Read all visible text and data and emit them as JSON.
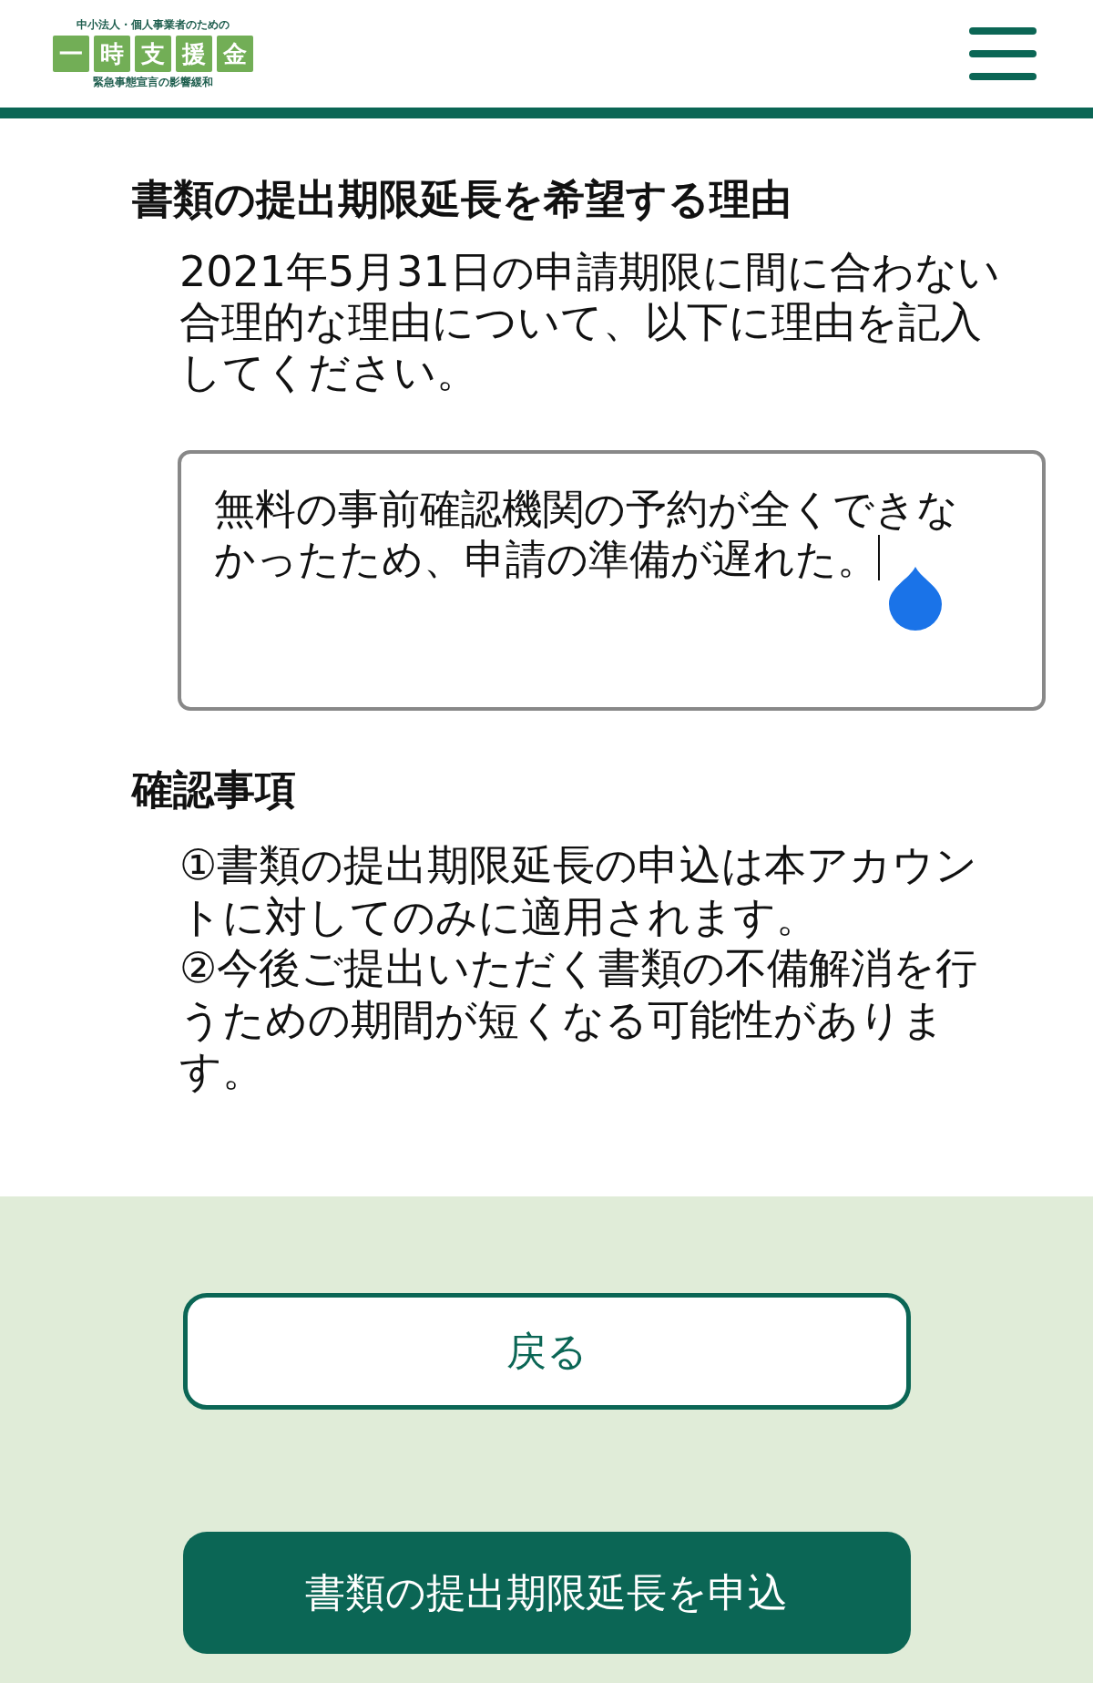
{
  "header": {
    "logo": {
      "tagline": "中小法人・個人事業者のための",
      "characters": [
        "一",
        "時",
        "支",
        "援",
        "金"
      ],
      "subtitle": "緊急事態宣言の影響緩和"
    }
  },
  "reason_section": {
    "heading": "書類の提出期限延長を希望する理由",
    "instructions": "2021年5月31日の申請期限に間に合わない合理的な理由について、以下に理由を記入してください。",
    "reason_field": {
      "value": "無料の事前確認機関の予約が全くできなかったため、申請の準備が遅れた。",
      "focused": true
    }
  },
  "confirmation_section": {
    "heading": "確認事項",
    "items": [
      "①書類の提出期限延長の申込は本アカウントに対してのみに適用されます。",
      "②今後ご提出いただく書類の不備解消を行うための期間が短くなる可能性があります。"
    ]
  },
  "buttons": [
    {
      "label": "戻る",
      "kind": "secondary"
    },
    {
      "label": "書類の提出期限延長を申込",
      "kind": "primary"
    }
  ]
}
